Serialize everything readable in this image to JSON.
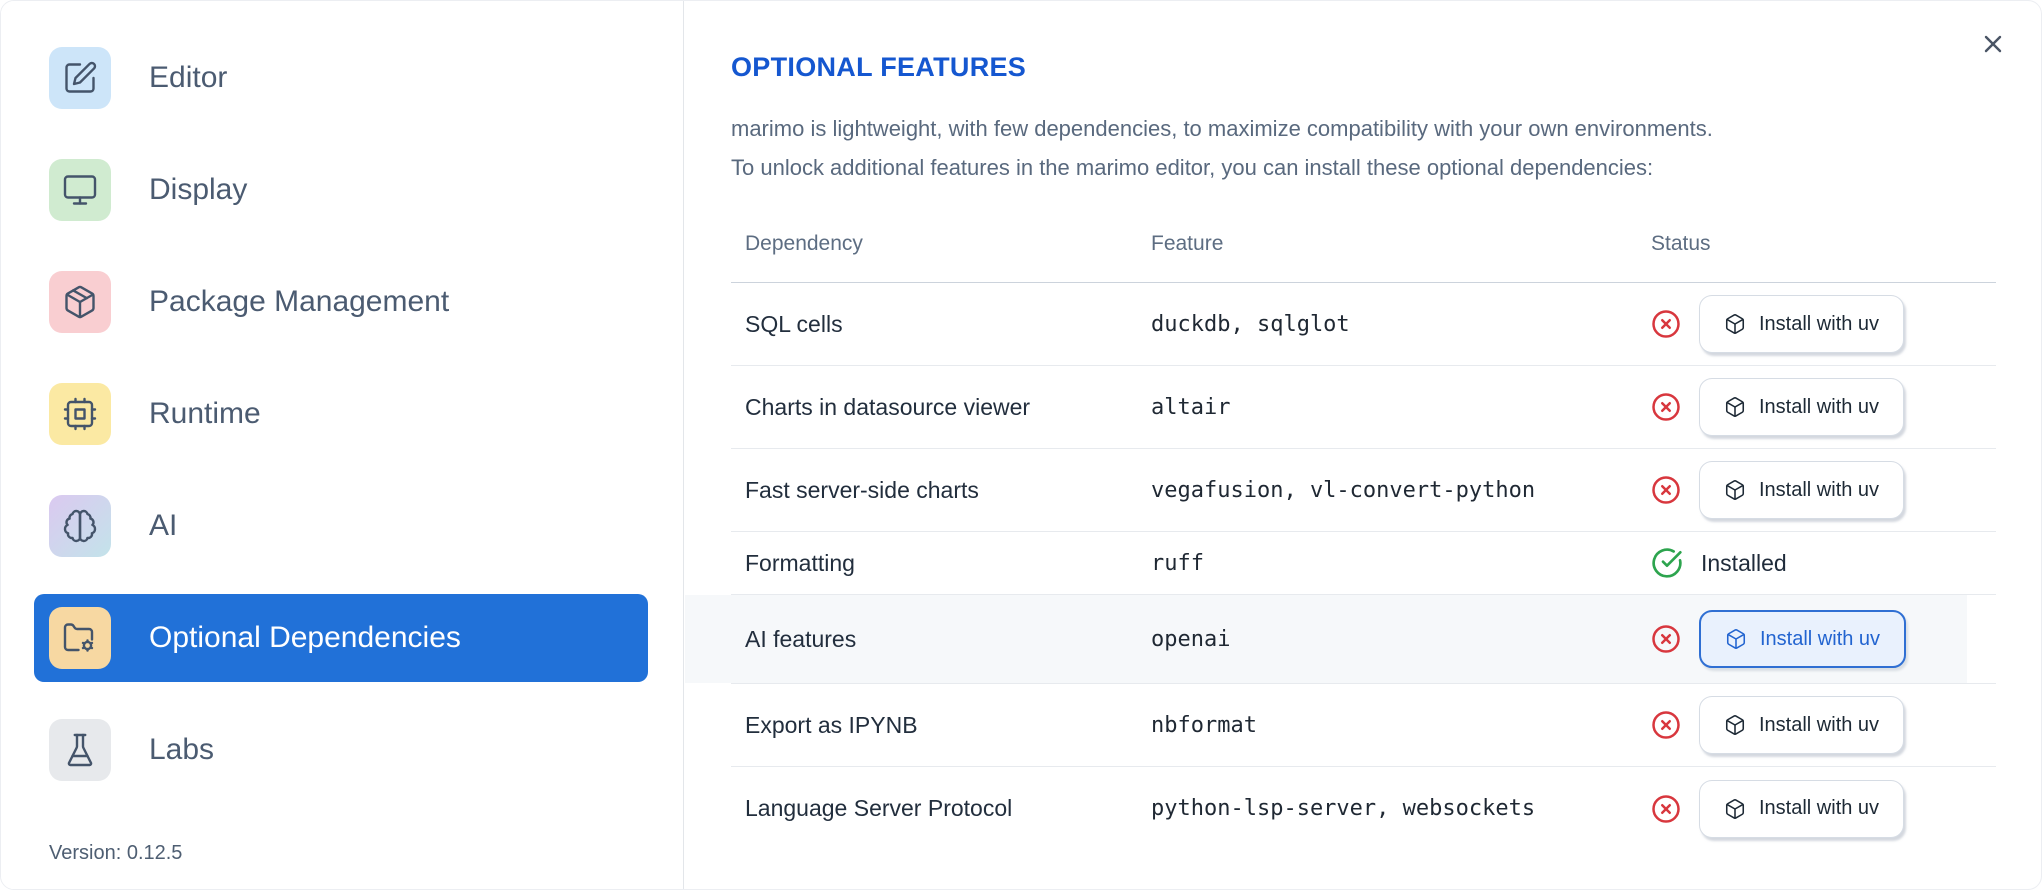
{
  "sidebar": {
    "items": [
      {
        "label": "Editor",
        "icon": "pencil-square-icon",
        "tile_style": "background:#cde5f9"
      },
      {
        "label": "Display",
        "icon": "monitor-icon",
        "tile_style": "background:#d0ebd0"
      },
      {
        "label": "Package Management",
        "icon": "package-icon",
        "tile_style": "background:#f9ced1"
      },
      {
        "label": "Runtime",
        "icon": "cpu-icon",
        "tile_style": "background:#fbe9a3"
      },
      {
        "label": "AI",
        "icon": "brain-icon",
        "tile_style": "background:linear-gradient(135deg,#dbc9f0 0%,#c3e3ea 100%)"
      },
      {
        "label": "Optional Dependencies",
        "icon": "folder-cog-icon",
        "tile_style": "background:#f7d8a2",
        "selected": true
      },
      {
        "label": "Labs",
        "icon": "flask-icon",
        "tile_style": "background:#e7e9ec"
      }
    ],
    "version": "Version: 0.12.5"
  },
  "dialog": {
    "title": "OPTIONAL FEATURES",
    "description_line1": "marimo is lightweight, with few dependencies, to maximize compatibility with your own environments.",
    "description_line2": "To unlock additional features in the marimo editor, you can install these optional dependencies:"
  },
  "table": {
    "columns": [
      "Dependency",
      "Feature",
      "Status"
    ],
    "install_button_label": "Install with uv",
    "installed_label": "Installed",
    "rows": [
      {
        "dependency": "SQL cells",
        "feature": "duckdb, sqlglot",
        "installed": false
      },
      {
        "dependency": "Charts in datasource viewer",
        "feature": "altair",
        "installed": false
      },
      {
        "dependency": "Fast server-side charts",
        "feature": "vegafusion, vl-convert-python",
        "installed": false
      },
      {
        "dependency": "Formatting",
        "feature": "ruff",
        "installed": true
      },
      {
        "dependency": "AI features",
        "feature": "openai",
        "installed": false,
        "highlighted": true
      },
      {
        "dependency": "Export as IPYNB",
        "feature": "nbformat",
        "installed": false
      },
      {
        "dependency": "Language Server Protocol",
        "feature": "python-lsp-server, websockets",
        "installed": false
      }
    ]
  },
  "colors": {
    "selected_nav_blue": "#2171d8",
    "title_blue": "#1557d0",
    "status_red": "#d8373e",
    "status_green": "#2da44e",
    "active_button_border": "#2f6fd3",
    "active_button_bg": "#e9f1fd",
    "active_button_text": "#2264d0",
    "highlight_row_bg": "#f6f8fa"
  }
}
